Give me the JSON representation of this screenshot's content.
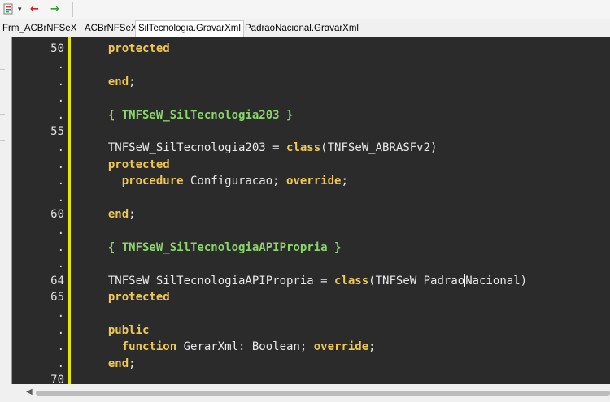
{
  "toolbar": {
    "menu_icon": "edit-menu-icon",
    "dropdown_glyph": "▾",
    "back_glyph": "←",
    "forward_glyph": "→"
  },
  "tabs": [
    {
      "label": "Frm_ACBrNFSeX"
    },
    {
      "label": "ACBrNFSeX"
    },
    {
      "label": "SilTecnologia.GravarXml"
    },
    {
      "label": "PadraoNacional.GravarXml"
    }
  ],
  "colors": {
    "editor_bg": "#2b2b2b",
    "keyword": "#f0c850",
    "directive": "#8ad66a",
    "gutter_bar": "#e6e600"
  },
  "lines": [
    {
      "num": "50",
      "tokens": [
        {
          "t": "  "
        },
        {
          "t": "protected",
          "c": "kw"
        }
      ]
    },
    {
      "num": ".",
      "tokens": []
    },
    {
      "num": ".",
      "tokens": [
        {
          "t": "  "
        },
        {
          "t": "end",
          "c": "kw"
        },
        {
          "t": ";"
        }
      ]
    },
    {
      "num": ".",
      "tokens": []
    },
    {
      "num": ".",
      "tokens": [
        {
          "t": "  "
        },
        {
          "t": "{ TNFSeW_SilTecnologia203 }",
          "c": "dir"
        }
      ]
    },
    {
      "num": "55",
      "tokens": []
    },
    {
      "num": ".",
      "tokens": [
        {
          "t": "  TNFSeW_SilTecnologia203 = "
        },
        {
          "t": "class",
          "c": "kw"
        },
        {
          "t": "(TNFSeW_ABRASFv2)"
        }
      ]
    },
    {
      "num": ".",
      "tokens": [
        {
          "t": "  "
        },
        {
          "t": "protected",
          "c": "kw"
        }
      ]
    },
    {
      "num": ".",
      "tokens": [
        {
          "t": "    "
        },
        {
          "t": "procedure",
          "c": "kw"
        },
        {
          "t": " Configuracao; "
        },
        {
          "t": "override",
          "c": "kw"
        },
        {
          "t": ";"
        }
      ]
    },
    {
      "num": ".",
      "tokens": []
    },
    {
      "num": "60",
      "tokens": [
        {
          "t": "  "
        },
        {
          "t": "end",
          "c": "kw"
        },
        {
          "t": ";"
        }
      ]
    },
    {
      "num": ".",
      "tokens": []
    },
    {
      "num": ".",
      "tokens": [
        {
          "t": "  "
        },
        {
          "t": "{ TNFSeW_SilTecnologiaAPIPropria }",
          "c": "dir"
        }
      ]
    },
    {
      "num": ".",
      "tokens": []
    },
    {
      "num": "64",
      "tokens": [
        {
          "t": "  TNFSeW_SilTecnologiaAPIPropria = "
        },
        {
          "t": "class",
          "c": "kw"
        },
        {
          "t": "(TNFSeW_Padrao"
        },
        {
          "caret": true
        },
        {
          "t": "Nacional)"
        }
      ]
    },
    {
      "num": "65",
      "tokens": [
        {
          "t": "  "
        },
        {
          "t": "protected",
          "c": "kw"
        }
      ]
    },
    {
      "num": ".",
      "tokens": []
    },
    {
      "num": ".",
      "tokens": [
        {
          "t": "  "
        },
        {
          "t": "public",
          "c": "kw"
        }
      ]
    },
    {
      "num": ".",
      "tokens": [
        {
          "t": "    "
        },
        {
          "t": "function",
          "c": "kw"
        },
        {
          "t": " GerarXml: Boolean; "
        },
        {
          "t": "override",
          "c": "kw"
        },
        {
          "t": ";"
        }
      ]
    },
    {
      "num": ".",
      "tokens": [
        {
          "t": "  "
        },
        {
          "t": "end",
          "c": "kw"
        },
        {
          "t": ";"
        }
      ]
    },
    {
      "num": "70",
      "tokens": []
    }
  ],
  "scrollbar": {
    "left_arrow": "◀"
  }
}
